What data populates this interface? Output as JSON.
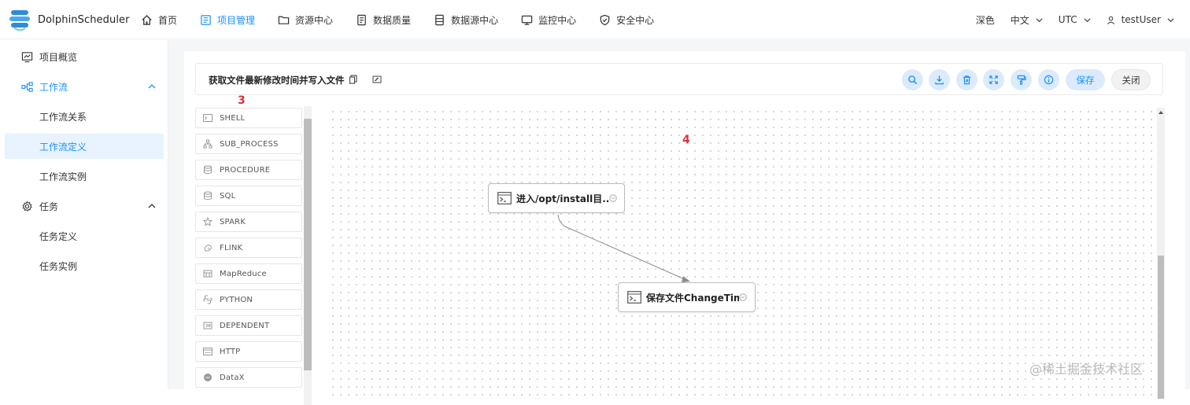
{
  "app": {
    "name": "DolphinScheduler"
  },
  "nav": {
    "items": [
      {
        "label": "首页",
        "icon": "home-icon"
      },
      {
        "label": "项目管理",
        "icon": "project-icon"
      },
      {
        "label": "资源中心",
        "icon": "folder-icon"
      },
      {
        "label": "数据质量",
        "icon": "document-icon"
      },
      {
        "label": "数据源中心",
        "icon": "datasource-icon"
      },
      {
        "label": "监控中心",
        "icon": "monitor-icon"
      },
      {
        "label": "安全中心",
        "icon": "shield-icon"
      }
    ],
    "active_index": 1,
    "right": {
      "theme": "深色",
      "language": "中文",
      "timezone": "UTC",
      "user": "testUser"
    }
  },
  "sidebar": {
    "overview": "项目概览",
    "workflow": "工作流",
    "workflow_relation": "工作流关系",
    "workflow_definition": "工作流定义",
    "workflow_instance": "工作流实例",
    "task": "任务",
    "task_definition": "任务定义",
    "task_instance": "任务实例"
  },
  "toolbar": {
    "workflow_name": "获取文件最新修改时间并写入文件",
    "save_label": "保存",
    "close_label": "关闭"
  },
  "palette": {
    "items": [
      "SHELL",
      "SUB_PROCESS",
      "PROCEDURE",
      "SQL",
      "SPARK",
      "FLINK",
      "MapReduce",
      "PYTHON",
      "DEPENDENT",
      "HTTP",
      "DataX"
    ]
  },
  "canvas": {
    "nodes": [
      {
        "label": "进入/opt/install目..."
      },
      {
        "label": "保存文件ChangeTime"
      }
    ]
  },
  "annotations": {
    "palette_marker": "3",
    "canvas_marker": "4"
  },
  "watermark": "@稀土掘金技术社区",
  "colors": {
    "accent": "#1890ff",
    "selected_bg": "#e8f3ff",
    "annotation": "#d8333b"
  }
}
